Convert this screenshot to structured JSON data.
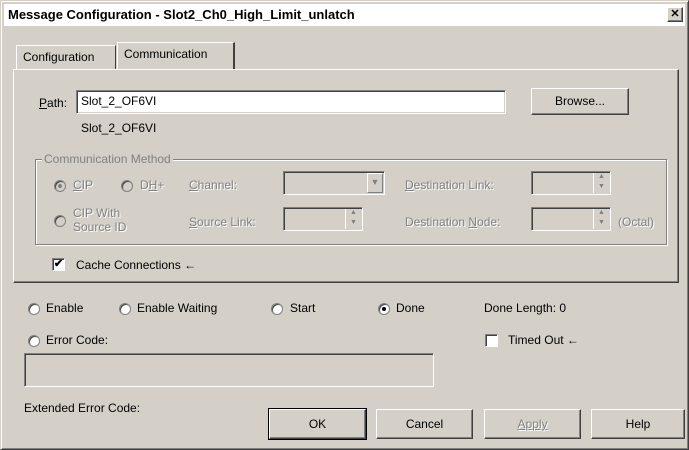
{
  "title": "Message Configuration - Slot2_Ch0_High_Limit_unlatch",
  "close_glyph": "✕",
  "tabs": [
    {
      "label": "Configuration"
    },
    {
      "label": "Communication"
    }
  ],
  "path": {
    "label": "Path:",
    "value": "Slot_2_OF6VI",
    "resolved": "Slot_2_OF6VI",
    "browse_label": "Browse..."
  },
  "comm_method": {
    "legend": "Communication Method",
    "cip_label": "CIP",
    "dhplus_label": "DH+",
    "cip_source_label_1": "CIP With",
    "cip_source_label_2": "Source ID",
    "channel_label": "Channel:",
    "source_link_label": "Source Link:",
    "dest_link_label": "Destination Link:",
    "dest_node_label": "Destination Node:",
    "octal_label": "(Octal)"
  },
  "cache": {
    "label": "Cache Connections",
    "checked": true,
    "arrow": "←"
  },
  "status": {
    "enable": "Enable",
    "enable_waiting": "Enable Waiting",
    "start": "Start",
    "done": "Done",
    "done_length": "Done Length: 0",
    "error_code": "Error Code:",
    "timed_out": "Timed Out",
    "timed_out_arrow": "←",
    "extended_error": "Extended Error Code:"
  },
  "buttons": {
    "ok": "OK",
    "cancel": "Cancel",
    "apply": "Apply",
    "help": "Help"
  },
  "glyphs": {
    "check": "✔",
    "dropdown": "▼",
    "spin_up": "▲",
    "spin_down": "▼"
  }
}
